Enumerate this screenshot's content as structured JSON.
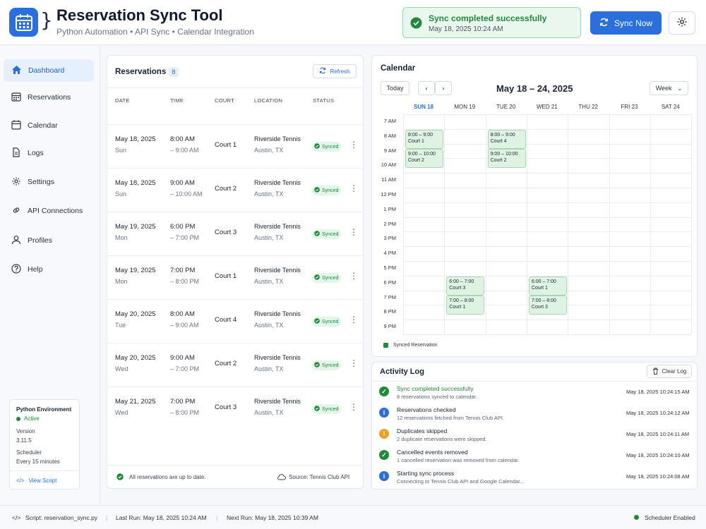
{
  "header": {
    "title": "Reservation Sync Tool",
    "subtitle": "Python Automation • API Sync • Calendar Integration",
    "toast_title": "Sync completed successfully",
    "toast_time": "May 18, 2025 10:24 AM",
    "sync_label": "Sync Now",
    "brace": "}"
  },
  "sidebar": {
    "items": [
      {
        "label": "Dashboard",
        "icon": "home-icon"
      },
      {
        "label": "Reservations",
        "icon": "calendar-grid-icon"
      },
      {
        "label": "Calendar",
        "icon": "calendar-icon"
      },
      {
        "label": "Logs",
        "icon": "document-icon"
      },
      {
        "label": "Settings",
        "icon": "gear-icon"
      },
      {
        "label": "API Connections",
        "icon": "link-icon"
      },
      {
        "label": "Profiles",
        "icon": "user-icon"
      },
      {
        "label": "Help",
        "icon": "help-icon"
      }
    ],
    "env": {
      "title": "Python Environment",
      "status": "Active",
      "version_label": "Version",
      "version": "3.11.5",
      "scheduler_label": "Scheduler",
      "scheduler": "Every 15 minutes",
      "view_script": "View Script"
    }
  },
  "reservations": {
    "title": "Reservations",
    "count": "8",
    "refresh_label": "Refresh",
    "columns": [
      "DATE",
      "TIME",
      "COURT",
      "LOCATION",
      "STATUS"
    ],
    "rows": [
      {
        "date": "May 18, 2025",
        "day": "Sun",
        "start": "8:00 AM",
        "end": "– 9:00 AM",
        "court": "Court 1",
        "location": "Riverside Tennis",
        "city": "Austin, TX",
        "status": "Synced"
      },
      {
        "date": "May 18, 2025",
        "day": "Sun",
        "start": "9:00 AM",
        "end": "– 10:00 AM",
        "court": "Court 2",
        "location": "Riverside Tennis",
        "city": "Austin, TX",
        "status": "Synced"
      },
      {
        "date": "May 19, 2025",
        "day": "Mon",
        "start": "6:00 PM",
        "end": "– 7:00 PM",
        "court": "Court 3",
        "location": "Riverside Tennis",
        "city": "Austin, TX",
        "status": "Synced"
      },
      {
        "date": "May 19, 2025",
        "day": "Mon",
        "start": "7:00 PM",
        "end": "– 8:00 PM",
        "court": "Court 1",
        "location": "Riverside Tennis",
        "city": "Austin, TX",
        "status": "Synced"
      },
      {
        "date": "May 20, 2025",
        "day": "Tue",
        "start": "8:00 AM",
        "end": "– 9:00 AM",
        "court": "Court 4",
        "location": "Riverside Tennis",
        "city": "Austin, TX",
        "status": "Synced"
      },
      {
        "date": "May 20, 2025",
        "day": "Wed",
        "start": "9:00 AM",
        "end": "– 7:00 PM",
        "court": "Court 2",
        "location": "Riverside Tennis",
        "city": "Austin, TX",
        "status": "Synced"
      },
      {
        "date": "May 21, 2025",
        "day": "Wed",
        "start": "7:00 PM",
        "end": "– 8:00 PM",
        "court": "Court 3",
        "location": "Riverside Tennis",
        "city": "Austin, TX",
        "status": "Synced"
      }
    ],
    "footer_status": "All reservations are up to date.",
    "footer_source": "Source: Tennis Club API"
  },
  "calendar": {
    "title": "Calendar",
    "today_label": "Today",
    "range": "May 18 – 24, 2025",
    "view_label": "Week",
    "days": [
      "SUN 18",
      "MON 19",
      "TUE 20",
      "WED 21",
      "THU 22",
      "FRI 23",
      "SAT 24"
    ],
    "hours": [
      "7 AM",
      "8 AM",
      "9 AM",
      "10 AM",
      "11 AM",
      "12 PM",
      "1 PM",
      "2 PM",
      "3 PM",
      "4 PM",
      "5 PM",
      "6 PM",
      "7 PM",
      "8 PM",
      "9 PM"
    ],
    "events": [
      {
        "day": 0,
        "hour": 1,
        "time": "8:00 – 9:00",
        "court": "Court 1"
      },
      {
        "day": 0,
        "hour": 2.3,
        "time": "9:00 – 10:00",
        "court": "Court 2"
      },
      {
        "day": 2,
        "hour": 1,
        "time": "8:00 – 9:00",
        "court": "Court 4"
      },
      {
        "day": 2,
        "hour": 2.3,
        "time": "9:00 – 10:00",
        "court": "Court 2"
      },
      {
        "day": 1,
        "hour": 11,
        "time": "6:00 – 7:00",
        "court": "Court 3"
      },
      {
        "day": 1,
        "hour": 12.3,
        "time": "7:00 – 8:00",
        "court": "Court 1"
      },
      {
        "day": 3,
        "hour": 11,
        "time": "6:00 – 7:00",
        "court": "Court 1"
      },
      {
        "day": 3,
        "hour": 12.3,
        "time": "7:00 – 8:00",
        "court": "Court 3"
      }
    ],
    "legend": "Synced Reservation",
    "highlight_color": "#2a6fdb"
  },
  "activity": {
    "title": "Activity Log",
    "clear_label": "Clear Log",
    "items": [
      {
        "title": "Sync completed successfully",
        "desc": "8 reservations synced to calendar.",
        "time": "May 18, 2025 10:24:15 AM",
        "type": "success"
      },
      {
        "title": "Reservations checked",
        "desc": "12 reservations fetched from Tennis Club API.",
        "time": "May 18, 2025 10:24:12 AM",
        "type": "info"
      },
      {
        "title": "Duplicates skipped",
        "desc": "2 duplicate reservations were skipped.",
        "time": "May 18, 2025 10:24:11 AM",
        "type": "warning"
      },
      {
        "title": "Cancelled events removed",
        "desc": "1 cancelled reservation was removed from calendar.",
        "time": "May 18, 2025 10:24:10 AM",
        "type": "success"
      },
      {
        "title": "Starting sync process",
        "desc": "Connecting to Tennis Club API and Google Calendar...",
        "time": "May 18, 2025 10:24:08 AM",
        "type": "info"
      }
    ]
  },
  "status_bar": {
    "script": "Script: reservation_sync.py",
    "last_run": "Last Run: May 18, 2025 10:24 AM",
    "next_run": "Next Run: May 18, 2025 10:39 AM",
    "scheduler": "Scheduler Enabled"
  },
  "colors": {
    "accent": "#2a6fdb",
    "success": "#1f8a3b",
    "warning": "#f0a020",
    "info": "#2a6fdb"
  }
}
